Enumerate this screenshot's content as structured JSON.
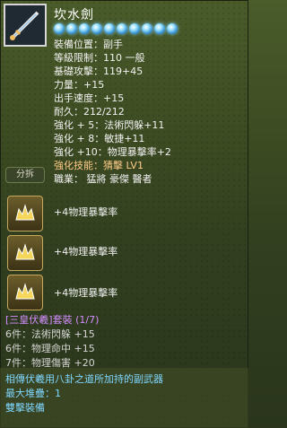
{
  "item": {
    "name": "坎水劍",
    "stats": [
      "裝備位置：副手",
      "等級限制：110   一般",
      "基礎攻擊：119+45",
      "力量：+15",
      "出手速度：+15",
      "耐久：212/212",
      "強化 + 5：法術閃躲+11",
      "強化 + 8：敏捷+11",
      "強化 +10：物理暴擊率+2"
    ],
    "skill": "強化技能：猜擊  LV1",
    "classes": "職業： 猛將  豪傑  醫者"
  },
  "split_button": "分拆",
  "slots": [
    {
      "text": "+4物理暴擊率"
    },
    {
      "text": "+4物理暴擊率"
    },
    {
      "text": "+4物理暴擊率"
    }
  ],
  "set": {
    "bracket_name": "[三皇伏羲]",
    "label": "套裝 (1/7)",
    "bonuses": [
      "6件：法術閃躲 +15",
      "6件：物理命中 +15",
      "7件：物理傷害 +20"
    ]
  },
  "description": [
    "相傳伏羲用八卦之道所加持的副武器",
    "最大堆疊：1",
    "雙擊裝備"
  ],
  "colors": {
    "gem": "#7fd4ff",
    "set_name": "#d38dff",
    "desc": "#7fd6ff"
  }
}
